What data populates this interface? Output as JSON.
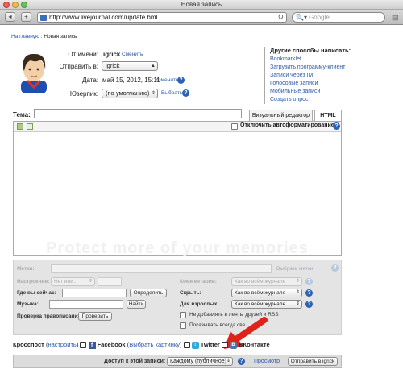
{
  "browser": {
    "window_title": "Новая запись",
    "url": "http://www.livejournal.com/update.bml",
    "search_placeholder": "Google"
  },
  "breadcrumb": {
    "home": "На главную",
    "sep": ":",
    "current": "Новая запись"
  },
  "form": {
    "from_label": "От имени:",
    "from_value": "igrick",
    "change_link": "Сменить",
    "post_to_label": "Отправить в:",
    "post_to_value": "igrick",
    "date_label": "Дата:",
    "date_value": "май 15, 2012, 15:11",
    "date_change": "Изменить",
    "userpic_label": "Юзерпик:",
    "userpic_value": "(по умолчанию)",
    "userpic_choose": "Выбрать"
  },
  "side": {
    "heading": "Другие способы написать:",
    "items": [
      "Bookmarklet",
      "Загрузить программу-клиент",
      "Записи через IM",
      "Голосовые записи",
      "Мобильные записи",
      "Создать опрос"
    ]
  },
  "subject": {
    "label": "Тема:"
  },
  "tabs": [
    "Визуальный редактор",
    "HTML"
  ],
  "editor": {
    "disable_autoformat": "Отключить автоформатирование",
    "ghost_text": "Protect more of your memories for..."
  },
  "meta": {
    "tags_label": "Метки:",
    "choose_tags": "Выбрать метки",
    "mood_label": "Настроение:",
    "mood_value": "Нет или...",
    "comments_label": "Комментарии:",
    "comments_value": "Как во всём журнале",
    "location_label": "Где вы сейчас:",
    "detect_button": "Определить",
    "screen_label": "Скрыть:",
    "screen_value": "Как во всём журнале",
    "music_label": "Музыка:",
    "find_button": "Найти",
    "adult_label": "Для взрослых:",
    "adult_value": "Как во всём журнале",
    "spellcheck_label": "Проверка правописания:",
    "check_button": "Проверить",
    "no_feed_label": "Не добавлять в ленты друзей и RSS",
    "show_always_label": "Показывать всегда све..."
  },
  "crosspost": {
    "label": "Кросспост",
    "setup": "настроить",
    "facebook": "Facebook",
    "choose_pic": "Выбрать картинку",
    "twitter": "Twitter",
    "vk": "ВКонтакте"
  },
  "access": {
    "label": "Доступ к этой записи:",
    "value": "Каждому (публичное)",
    "preview": "Просмотр",
    "submit": "Отправить в igrick"
  },
  "colors": {
    "link": "#2b5aa8",
    "help": "#2c62b3",
    "arrow": "#e0221b"
  }
}
